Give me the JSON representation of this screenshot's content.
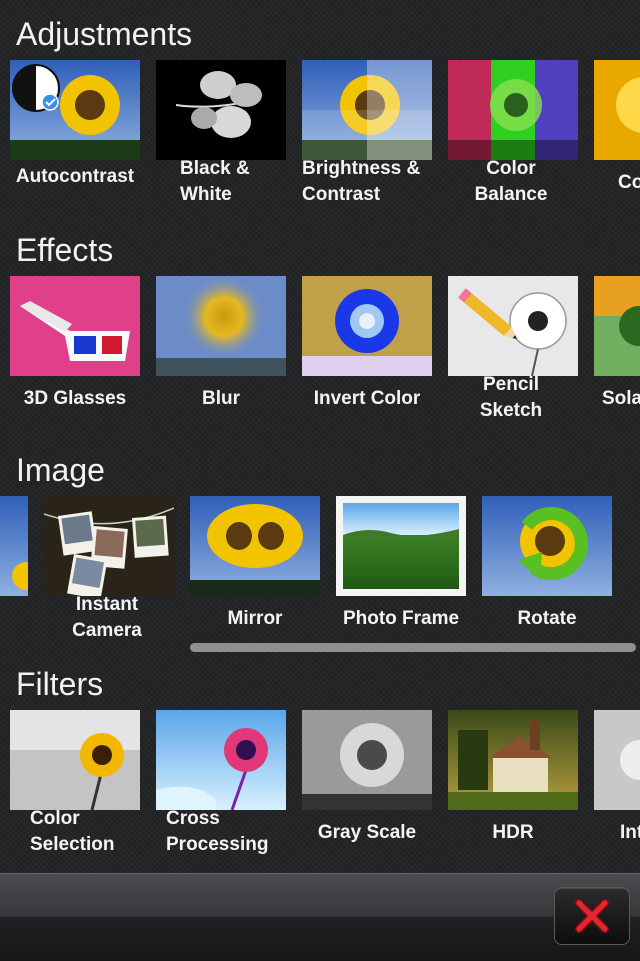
{
  "sections": {
    "adjustments": {
      "title": "Adjustments",
      "items": [
        "Autocontrast",
        "Black &\nWhite",
        "Brightness &\nContrast",
        "Color\nBalance",
        "Co"
      ]
    },
    "effects": {
      "title": "Effects",
      "items": [
        "3D Glasses",
        "Blur",
        "Invert Color",
        "Pencil\nSketch",
        "Sola"
      ]
    },
    "image": {
      "title": "Image",
      "items": [
        "Instant\nCamera",
        "Mirror",
        "Photo Frame",
        "Rotate"
      ]
    },
    "filters": {
      "title": "Filters",
      "items": [
        "Color\nSelection",
        "Cross\nProcessing",
        "Gray Scale",
        "HDR",
        "Int"
      ]
    }
  },
  "icons": {
    "close": "close-x-icon"
  },
  "colors": {
    "background": "#222426",
    "close_x": "#d8232a"
  }
}
